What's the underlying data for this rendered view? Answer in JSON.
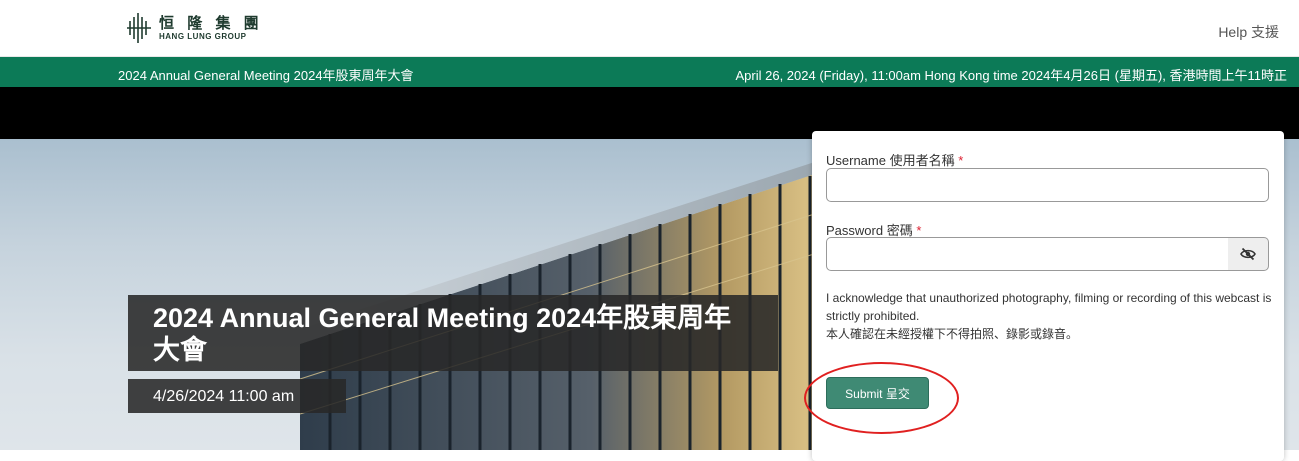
{
  "header": {
    "logo_cn": "恒 隆 集 團",
    "logo_en": "HANG LUNG GROUP",
    "help_label": "Help 支援"
  },
  "banner": {
    "event_name": "2024 Annual General Meeting 2024年股東周年大會",
    "event_datetime": "April 26, 2024 (Friday), 11:00am Hong Kong time 2024年4月26日 (星期五), 香港時間上午11時正"
  },
  "hero": {
    "title": "2024 Annual General Meeting 2024年股東周年大會",
    "date": "4/26/2024 11:00 am"
  },
  "login": {
    "username_label": "Username 使用者名稱",
    "username_value": "",
    "password_label": "Password 密碼",
    "password_value": "",
    "required_mark": "*",
    "ack_en": "I acknowledge that unauthorized photography, filming or recording of this webcast is strictly prohibited.",
    "ack_cn": "本人確認在未經授權下不得拍照、錄影或錄音。",
    "submit_label": "Submit 呈交"
  },
  "colors": {
    "brand_green": "#0c7a57",
    "button_green": "#3f8a74",
    "annotation_red": "#e02020"
  },
  "icons": {
    "password_toggle": "eye-slash-icon"
  }
}
